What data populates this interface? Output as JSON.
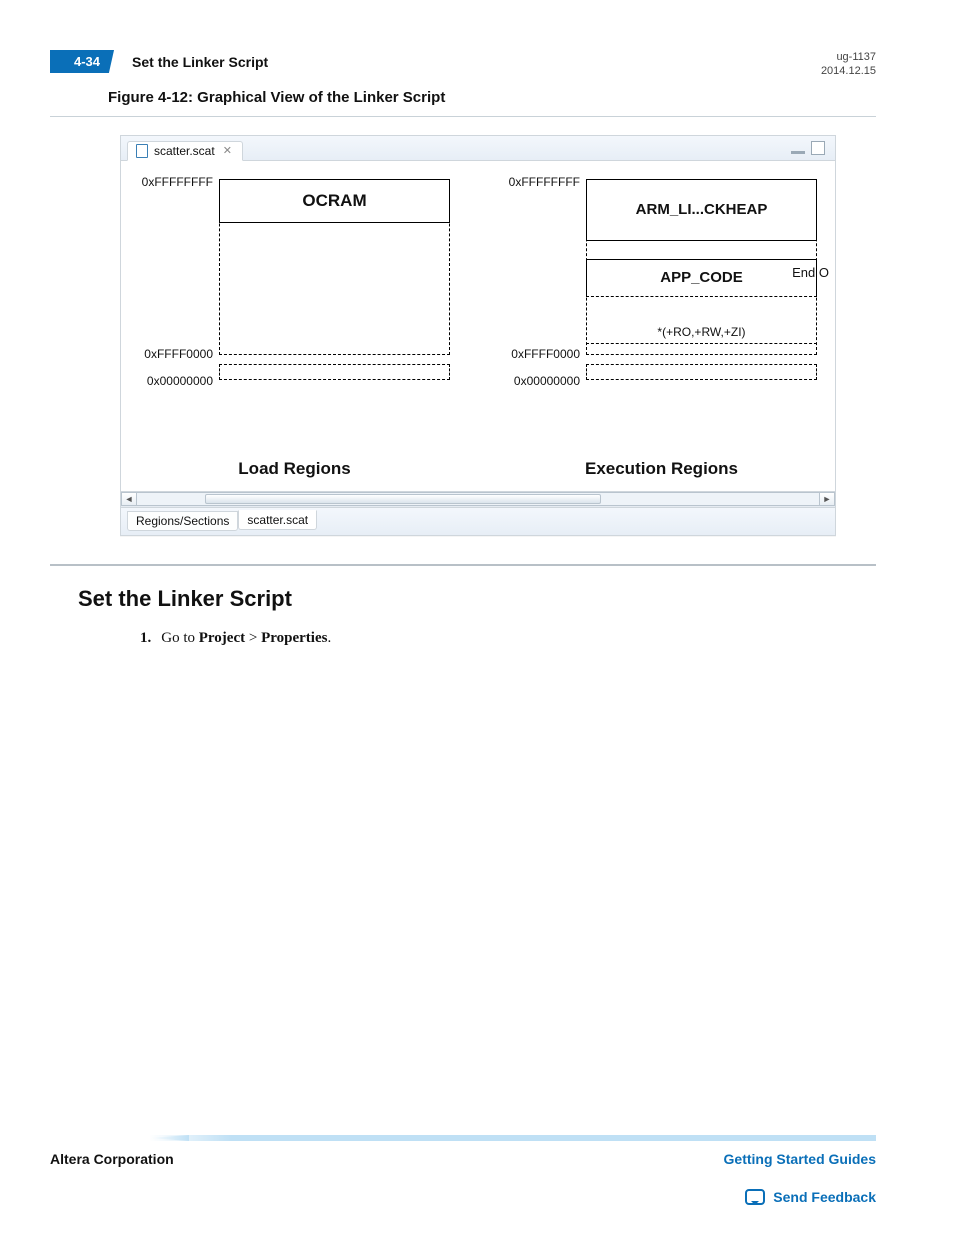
{
  "header": {
    "page_number": "4-34",
    "title": "Set the Linker Script",
    "doc_id": "ug-1137",
    "date": "2014.12.15"
  },
  "figure": {
    "caption": "Figure 4-12: Graphical View of the Linker Script",
    "editor_tab": "scatter.scat",
    "load": {
      "title": "Load Regions",
      "top_addr": "0xFFFFFFFF",
      "mid_addr": "0xFFFF0000",
      "bot_addr": "0x00000000",
      "region_name": "OCRAM"
    },
    "exec": {
      "title": "Execution Regions",
      "top_addr": "0xFFFFFFFF",
      "mid_addr": "0xFFFF0000",
      "bot_addr": "0x00000000",
      "heap_name": "ARM_LI...CKHEAP",
      "code_name": "APP_CODE",
      "code_sections": "*(+RO,+RW,+ZI)",
      "clipped_label": "End O"
    },
    "bottom_tabs": {
      "left": "Regions/Sections",
      "right": "scatter.scat"
    }
  },
  "section": {
    "heading": "Set the Linker Script",
    "step_num": "1.",
    "step_prefix": "Go to ",
    "step_bold1": "Project",
    "step_sep": " > ",
    "step_bold2": "Properties",
    "step_suffix": "."
  },
  "footer": {
    "company": "Altera Corporation",
    "guide_link": "Getting Started Guides",
    "feedback": "Send Feedback"
  }
}
